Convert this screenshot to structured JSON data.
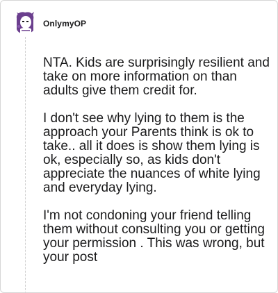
{
  "comment": {
    "author": "OnlymyOP",
    "paragraphs": [
      "NTA. Kids are surprisingly resilient and take on more information on than adults give them credit for.",
      "I don't see why lying to them is the approach your Parents think is ok to take.. all it does is show them lying is ok, especially so, as kids don't appreciate the nuances of white lying and everyday lying.",
      "I'm not condoning your friend telling them without consulting you or getting your permission . This was wrong, but your post"
    ]
  },
  "icons": {
    "avatar": "user-avatar-icon"
  },
  "colors": {
    "text": "#1a1a1b",
    "avatar_purple": "#6b3f8e",
    "border": "#d6d6d6"
  }
}
